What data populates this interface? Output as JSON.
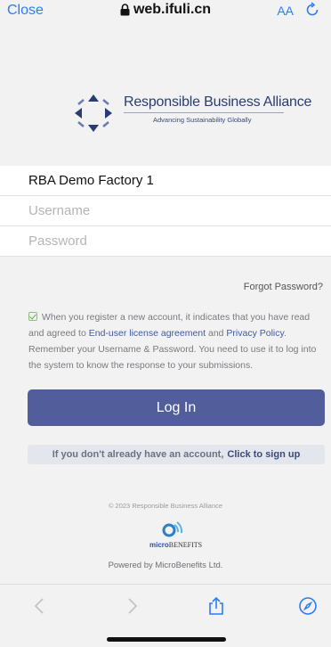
{
  "browser": {
    "close_label": "Close",
    "url": "web.ifuli.cn",
    "text_size_label": "AA",
    "icons": [
      "lock-icon",
      "reload-icon",
      "back-icon",
      "forward-icon",
      "share-icon",
      "compass-icon"
    ]
  },
  "logo": {
    "title": "Responsible Business Alliance",
    "tagline": "Advancing Sustainability Globally"
  },
  "form": {
    "company": "RBA Demo Factory 1",
    "username_placeholder": "Username",
    "password_placeholder": "Password",
    "forgot_label": "Forgot Password?",
    "agree_text_1": "When you register a new account, it indicates that you have read and agreed to ",
    "eula_link": "End-user license agreement",
    "agree_and": " and ",
    "privacy_link": "Privacy Policy",
    "agree_text_2": ". Remember your Username & Password. You need to use it to log into the system to know the response to your submissions.",
    "login_label": "Log In",
    "signup_prompt": "If you don't already have an account,",
    "signup_link": "Click to sign up"
  },
  "footer": {
    "copyright": "© 2023 Responsible Business Alliance",
    "mb_brand_prefix": "micro",
    "mb_brand_suffix": "BENEFITS",
    "powered_by": "Powered by MicroBenefits Ltd."
  },
  "colors": {
    "primary_button": "#525e9c",
    "link": "#2d7bf6",
    "brand_navy": "#2a3c72"
  }
}
